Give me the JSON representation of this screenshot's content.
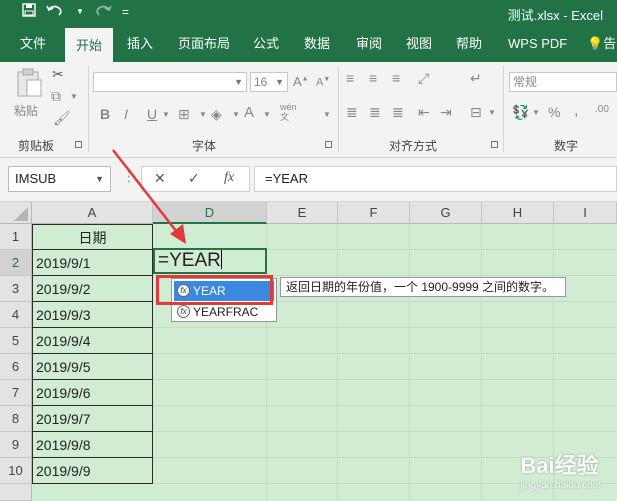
{
  "window": {
    "document_title": "测试.xlsx  -  Excel",
    "qat": {
      "save_icon": "save-icon",
      "undo_icon": "undo-icon",
      "redo_icon": "redo-icon",
      "more": "="
    }
  },
  "tabs": [
    {
      "label": "文件"
    },
    {
      "label": "开始",
      "active": true
    },
    {
      "label": "插入"
    },
    {
      "label": "页面布局"
    },
    {
      "label": "公式"
    },
    {
      "label": "数据"
    },
    {
      "label": "审阅"
    },
    {
      "label": "视图"
    },
    {
      "label": "帮助"
    },
    {
      "label": "WPS PDF"
    },
    {
      "label": "告"
    }
  ],
  "ribbon": {
    "clipboard": {
      "label": "剪贴板",
      "paste_label": "粘贴"
    },
    "font": {
      "label": "字体",
      "size_value": "16",
      "bold": "B",
      "italic": "I",
      "underline": "U",
      "wen": "wén"
    },
    "alignment": {
      "label": "对齐方式"
    },
    "number": {
      "label": "数字",
      "format_value": "常规",
      "percent": "%"
    }
  },
  "formula_bar": {
    "name_box": "IMSUB",
    "cancel": "✕",
    "enter": "✓",
    "fx": "fx",
    "formula": "=YEAR"
  },
  "grid": {
    "columns": [
      "A",
      "D",
      "E",
      "F",
      "G",
      "H",
      "I"
    ],
    "rows": [
      "1",
      "2",
      "3",
      "4",
      "5",
      "6",
      "7",
      "8",
      "9",
      "10"
    ],
    "A": [
      "日期",
      "2019/9/1",
      "2019/9/2",
      "2019/9/3",
      "2019/9/4",
      "2019/9/5",
      "2019/9/6",
      "2019/9/7",
      "2019/9/8",
      "2019/9/9"
    ],
    "active_cell_text": "=YEAR"
  },
  "autocomplete": {
    "items": [
      {
        "label": "YEAR",
        "highlighted": true
      },
      {
        "label": "YEARFRAC",
        "highlighted": false
      }
    ],
    "tooltip": "返回日期的年份值，一个 1900-9999 之间的数字。"
  },
  "watermark": {
    "brand": "Bai经验",
    "url": "jingyan.baidu.com"
  },
  "colors": {
    "accent": "#217346",
    "grid_bg": "#d0ecd3",
    "highlight": "#3a88e0",
    "annotation": "#e03a3a"
  }
}
